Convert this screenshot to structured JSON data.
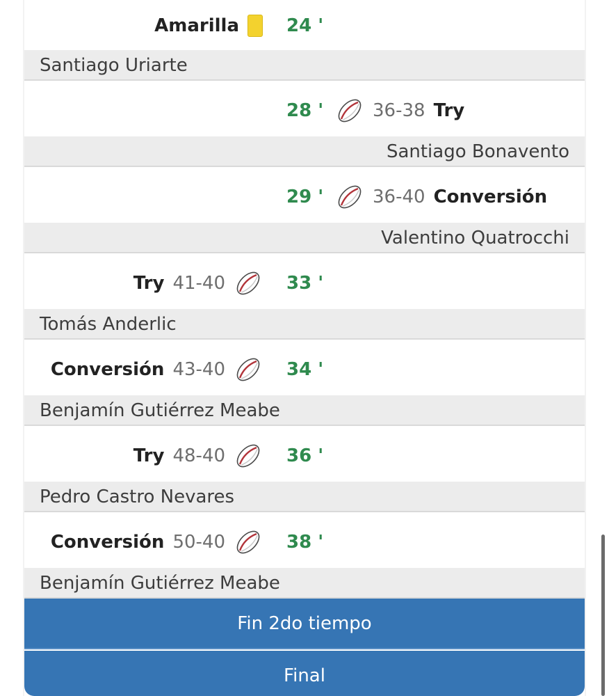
{
  "events": [
    {
      "side": "left",
      "type": "Amarilla",
      "icon": "yellow-card-icon",
      "minute": "24 '",
      "player": "Santiago Uriarte"
    },
    {
      "side": "right",
      "type": "Try",
      "score": "36-38",
      "icon": "rugby-ball-icon",
      "minute": "28 '",
      "player": "Santiago Bonavento"
    },
    {
      "side": "right",
      "type": "Conversión",
      "score": "36-40",
      "icon": "rugby-ball-icon",
      "minute": "29 '",
      "player": "Valentino Quatrocchi"
    },
    {
      "side": "left",
      "type": "Try",
      "score": "41-40",
      "icon": "rugby-ball-icon",
      "minute": "33 '",
      "player": "Tomás Anderlic"
    },
    {
      "side": "left",
      "type": "Conversión",
      "score": "43-40",
      "icon": "rugby-ball-icon",
      "minute": "34 '",
      "player": "Benjamín Gutiérrez Meabe"
    },
    {
      "side": "left",
      "type": "Try",
      "score": "48-40",
      "icon": "rugby-ball-icon",
      "minute": "36 '",
      "player": "Pedro Castro Nevares"
    },
    {
      "side": "left",
      "type": "Conversión",
      "score": "50-40",
      "icon": "rugby-ball-icon",
      "minute": "38 '",
      "player": "Benjamín Gutiérrez Meabe"
    }
  ],
  "buttons": {
    "fin_2do_tiempo": "Fin 2do tiempo",
    "final": "Final"
  },
  "colors": {
    "minute": "#2f8a4e",
    "button": "#3675b4",
    "player_row": "#ececec",
    "yellow_card": "#f3d22e"
  }
}
